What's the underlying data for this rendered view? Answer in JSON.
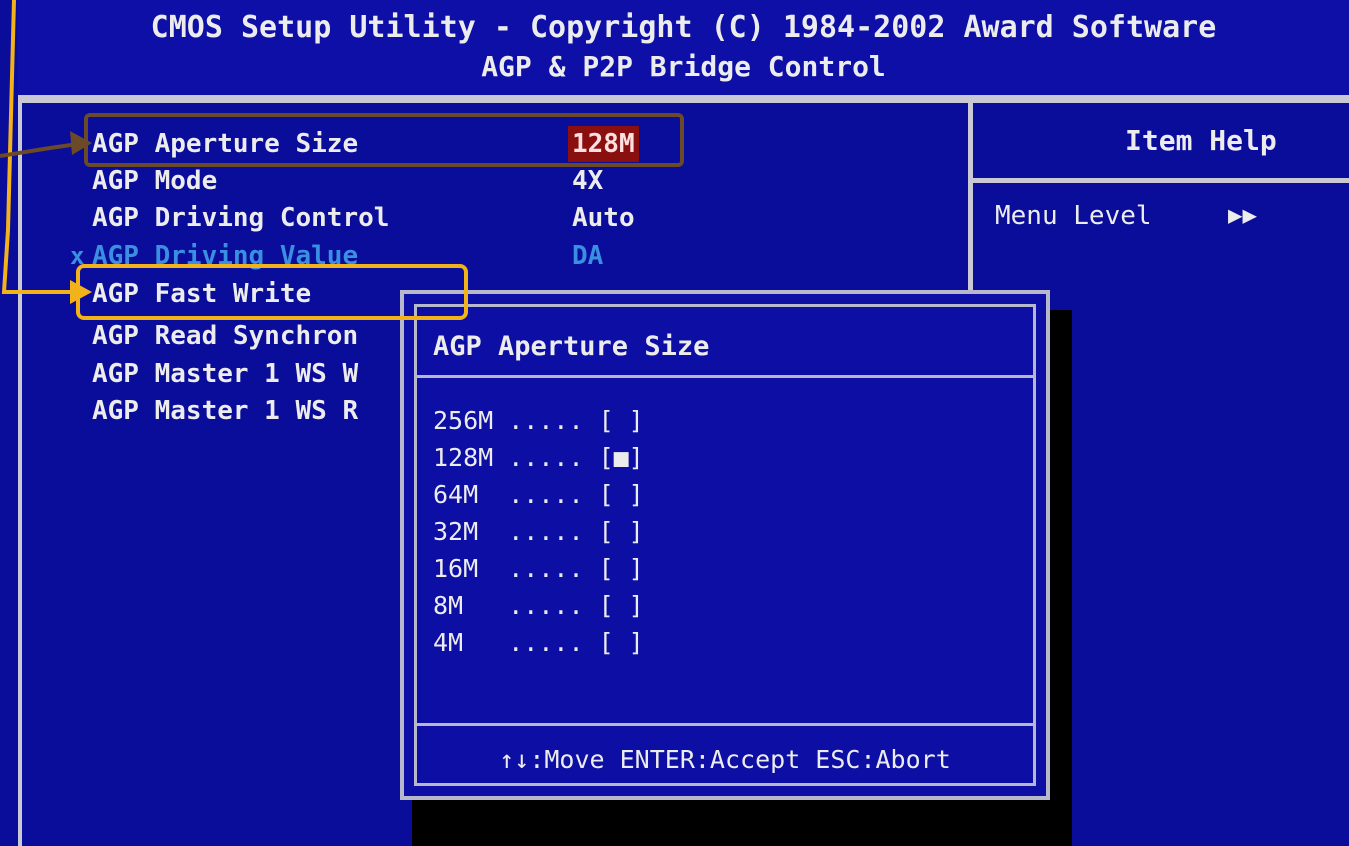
{
  "header": {
    "title": "CMOS Setup Utility - Copyright (C) 1984-2002 Award Software",
    "subtitle": "AGP & P2P Bridge Control"
  },
  "help_panel": {
    "title": "Item Help",
    "menu_level_label": "Menu Level",
    "menu_level_arrows": "▶▶"
  },
  "settings": [
    {
      "label": "AGP Aperture Size",
      "value": "128M"
    },
    {
      "label": "AGP Mode",
      "value": "4X"
    },
    {
      "label": "AGP Driving Control",
      "value": "Auto"
    },
    {
      "label": "AGP Driving Value",
      "value": "DA",
      "mark": "x"
    },
    {
      "label": "AGP Fast Write",
      "value": ""
    },
    {
      "label": "AGP Read Synchron",
      "value": ""
    },
    {
      "label": "AGP Master 1 WS W",
      "value": ""
    },
    {
      "label": "AGP Master 1 WS R",
      "value": ""
    }
  ],
  "popup": {
    "title": "AGP Aperture Size",
    "options": [
      "256M ..... [ ]",
      "128M ..... [■]",
      "64M  ..... [ ]",
      "32M  ..... [ ]",
      "16M  ..... [ ]",
      "8M   ..... [ ]",
      "4M   ..... [ ]"
    ],
    "hint": "↑↓:Move ENTER:Accept ESC:Abort"
  },
  "colors": {
    "background": "#0a0c9a",
    "text": "#ececec",
    "disabled_text": "#3a8fe0",
    "selected_value_bg": "#8a1010",
    "annotation_brown": "#6a4a28",
    "annotation_orange": "#f2b21a"
  }
}
